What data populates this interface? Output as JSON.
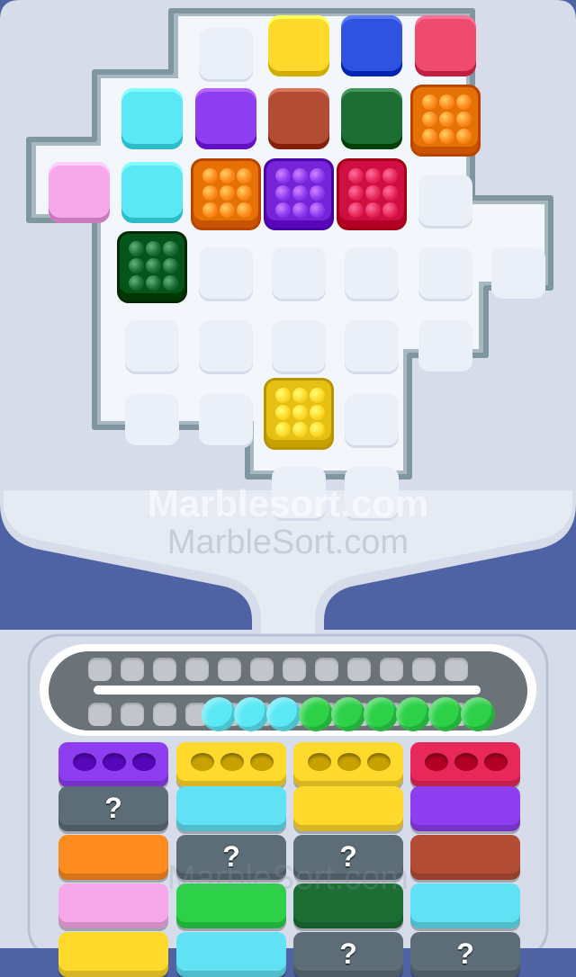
{
  "watermarks": {
    "primary": "Marblesort.com",
    "secondary": "MarbleSort.com"
  },
  "colors": {
    "purple": "#8e3df0",
    "yellow": "#ffd92c",
    "blue": "#2f52e0",
    "pink": "#ee4b6f",
    "cyan": "#5be8f5",
    "brown": "#b34c34",
    "dark_green": "#1c6e35",
    "light_pink": "#f7a8ea",
    "orange": "#ff8a1e",
    "magenta": "#e8285a",
    "green": "#2cd148",
    "gray": "#5d6d78",
    "light_cyan": "#61e2f4",
    "empty": "#eaeff8"
  },
  "board": {
    "plain_blocks": [
      {
        "color": "yellow",
        "row": 0,
        "col": 3
      },
      {
        "color": "blue",
        "row": 0,
        "col": 4
      },
      {
        "color": "pink",
        "row": 0,
        "col": 5
      },
      {
        "color": "cyan",
        "row": 1,
        "col": 1
      },
      {
        "color": "purple",
        "row": 1,
        "col": 2
      },
      {
        "color": "brown",
        "row": 1,
        "col": 3
      },
      {
        "color": "dark_green",
        "row": 1,
        "col": 4
      },
      {
        "color": "light_pink",
        "row": 2,
        "col": 0
      },
      {
        "color": "cyan",
        "row": 2,
        "col": 1
      }
    ],
    "marble_blocks": [
      {
        "color": "orange",
        "row": 1,
        "col": 5
      },
      {
        "color": "orange",
        "row": 2,
        "col": 2
      },
      {
        "color": "purple",
        "row": 2,
        "col": 3
      },
      {
        "color": "magenta",
        "row": 2,
        "col": 4
      },
      {
        "color": "dark_green",
        "row": 3,
        "col": 1
      },
      {
        "color": "yellow",
        "row": 5,
        "col": 3
      }
    ],
    "empty_cells": [
      {
        "row": 0,
        "col": 2
      },
      {
        "row": 2,
        "col": 5
      },
      {
        "row": 3,
        "col": 2
      },
      {
        "row": 3,
        "col": 3
      },
      {
        "row": 3,
        "col": 4
      },
      {
        "row": 3,
        "col": 5
      },
      {
        "row": 3,
        "col": 6
      },
      {
        "row": 4,
        "col": 1
      },
      {
        "row": 4,
        "col": 2
      },
      {
        "row": 4,
        "col": 3
      },
      {
        "row": 4,
        "col": 4
      },
      {
        "row": 4,
        "col": 5
      },
      {
        "row": 5,
        "col": 1
      },
      {
        "row": 5,
        "col": 2
      },
      {
        "row": 5,
        "col": 4
      },
      {
        "row": 6,
        "col": 3
      },
      {
        "row": 6,
        "col": 4
      }
    ]
  },
  "conveyor": {
    "marbles": [
      "cyan",
      "cyan",
      "cyan",
      "green",
      "green",
      "green",
      "green",
      "green",
      "green"
    ]
  },
  "tubes": [
    [
      {
        "color": "purple",
        "holes": 3
      },
      {
        "color": "gray",
        "mystery": "?"
      },
      {
        "color": "orange"
      },
      {
        "color": "light_pink"
      },
      {
        "color": "yellow"
      }
    ],
    [
      {
        "color": "yellow",
        "holes": 3
      },
      {
        "color": "light_cyan"
      },
      {
        "color": "gray",
        "mystery": "?"
      },
      {
        "color": "green"
      },
      {
        "color": "light_cyan"
      }
    ],
    [
      {
        "color": "yellow",
        "holes": 3
      },
      {
        "color": "yellow"
      },
      {
        "color": "gray",
        "mystery": "?"
      },
      {
        "color": "dark_green"
      },
      {
        "color": "gray",
        "mystery": "?"
      }
    ],
    [
      {
        "color": "magenta",
        "holes": 3
      },
      {
        "color": "purple"
      },
      {
        "color": "brown"
      },
      {
        "color": "light_cyan"
      },
      {
        "color": "gray",
        "mystery": "?"
      }
    ]
  ]
}
